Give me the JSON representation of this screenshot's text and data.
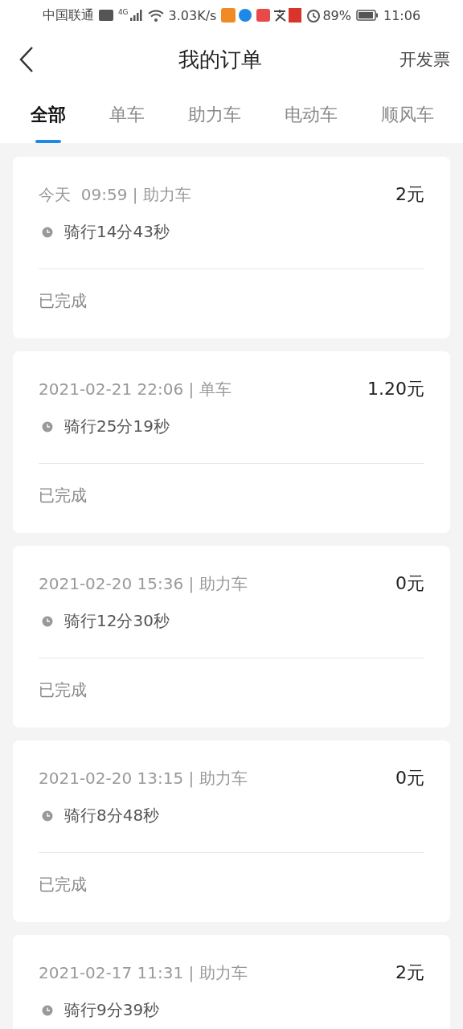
{
  "status_bar": {
    "carrier": "中国联通",
    "network": "4G",
    "speed": "3.03K/s",
    "battery": "89%",
    "time": "11:06"
  },
  "header": {
    "title": "我的订单",
    "action": "开发票"
  },
  "tabs": [
    {
      "label": "全部",
      "selected": true
    },
    {
      "label": "单车",
      "selected": false
    },
    {
      "label": "助力车",
      "selected": false
    },
    {
      "label": "电动车",
      "selected": false
    },
    {
      "label": "顺风车",
      "selected": false
    }
  ],
  "orders": [
    {
      "time": "今天  09:59 | 助力车",
      "price": "2元",
      "duration": "骑行14分43秒",
      "status": "已完成"
    },
    {
      "time": "2021-02-21 22:06 | 单车",
      "price": "1.20元",
      "duration": "骑行25分19秒",
      "status": "已完成"
    },
    {
      "time": "2021-02-20 15:36 | 助力车",
      "price": "0元",
      "duration": "骑行12分30秒",
      "status": "已完成"
    },
    {
      "time": "2021-02-20 13:15 | 助力车",
      "price": "0元",
      "duration": "骑行8分48秒",
      "status": "已完成"
    },
    {
      "time": "2021-02-17 11:31 | 助力车",
      "price": "2元",
      "duration": "骑行9分39秒"
    }
  ]
}
